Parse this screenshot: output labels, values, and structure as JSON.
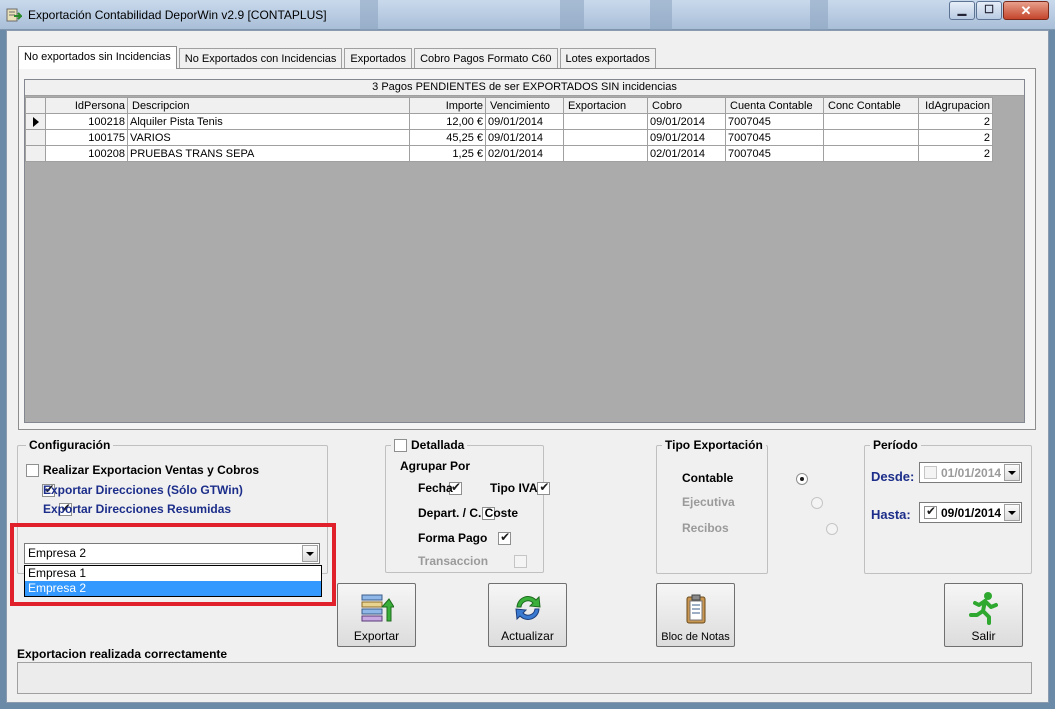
{
  "window": {
    "title": "Exportación Contabilidad DeporWin v2.9   [CONTAPLUS]",
    "minimize_icon": "minimize-icon",
    "maximize_icon": "maximize-icon",
    "close_icon": "close-icon"
  },
  "tabs": [
    {
      "label": "No exportados sin Incidencias",
      "active": true
    },
    {
      "label": "No Exportados con Incidencias",
      "active": false
    },
    {
      "label": "Exportados",
      "active": false
    },
    {
      "label": "Cobro Pagos Formato C60",
      "active": false
    },
    {
      "label": "Lotes exportados",
      "active": false
    }
  ],
  "grid": {
    "caption": "3 Pagos PENDIENTES de ser EXPORTADOS SIN incidencias",
    "columns": [
      "IdPersona",
      "Descripcion",
      "Importe",
      "Vencimiento",
      "Exportacion",
      "Cobro",
      "Cuenta Contable",
      "Conc Contable",
      "IdAgrupacion"
    ],
    "rows": [
      {
        "current": true,
        "cells": [
          "100218",
          "Alquiler Pista Tenis",
          "12,00 €",
          "09/01/2014",
          "",
          "09/01/2014",
          "7007045",
          "",
          "2"
        ]
      },
      {
        "current": false,
        "cells": [
          "100175",
          "VARIOS",
          "45,25 €",
          "09/01/2014",
          "",
          "09/01/2014",
          "7007045",
          "",
          "2"
        ]
      },
      {
        "current": false,
        "cells": [
          "100208",
          "PRUEBAS TRANS SEPA",
          "1,25 €",
          "02/01/2014",
          "",
          "02/01/2014",
          "7007045",
          "",
          "2"
        ]
      }
    ]
  },
  "configuracion": {
    "title": "Configuración",
    "opt1": {
      "label": "Realizar Exportacion Ventas y Cobros",
      "checked": false
    },
    "opt2": {
      "label": "Exportar Direcciones (Sólo GTWin)",
      "checked": true
    },
    "opt3": {
      "label": "Exportar Direcciones Resumidas",
      "checked": true
    },
    "empresa_selected": "Empresa 2",
    "empresa_options": [
      "Empresa 1",
      "Empresa 2"
    ]
  },
  "detallada": {
    "title": "Detallada",
    "checked": false,
    "agrupar_por": "Agrupar Por",
    "fecha": {
      "label": "Fecha",
      "checked": true
    },
    "tipo_iva": {
      "label": "Tipo IVA",
      "checked": true
    },
    "depart": {
      "label": "Depart. / C. Coste",
      "checked": false
    },
    "forma_pago": {
      "label": "Forma Pago",
      "checked": true
    },
    "transaccion": {
      "label": "Transaccion",
      "checked": false
    }
  },
  "tipo_exportacion": {
    "title": "Tipo Exportación",
    "contable": "Contable",
    "ejecutiva": "Ejecutiva",
    "recibos": "Recibos",
    "selected": "Contable"
  },
  "periodo": {
    "title": "Período",
    "desde_label": "Desde:",
    "desde_value": "01/01/2014",
    "desde_checked": false,
    "hasta_label": "Hasta:",
    "hasta_value": "09/01/2014",
    "hasta_checked": true
  },
  "buttons": {
    "exportar": "Exportar",
    "actualizar": "Actualizar",
    "bloc_notas": "Bloc de Notas",
    "salir": "Salir"
  },
  "status": {
    "message": "Exportacion realizada correctamente"
  },
  "colors": {
    "highlight": "#e0202a",
    "selection": "#3399ff",
    "label_blue": "#1c2e8a"
  }
}
